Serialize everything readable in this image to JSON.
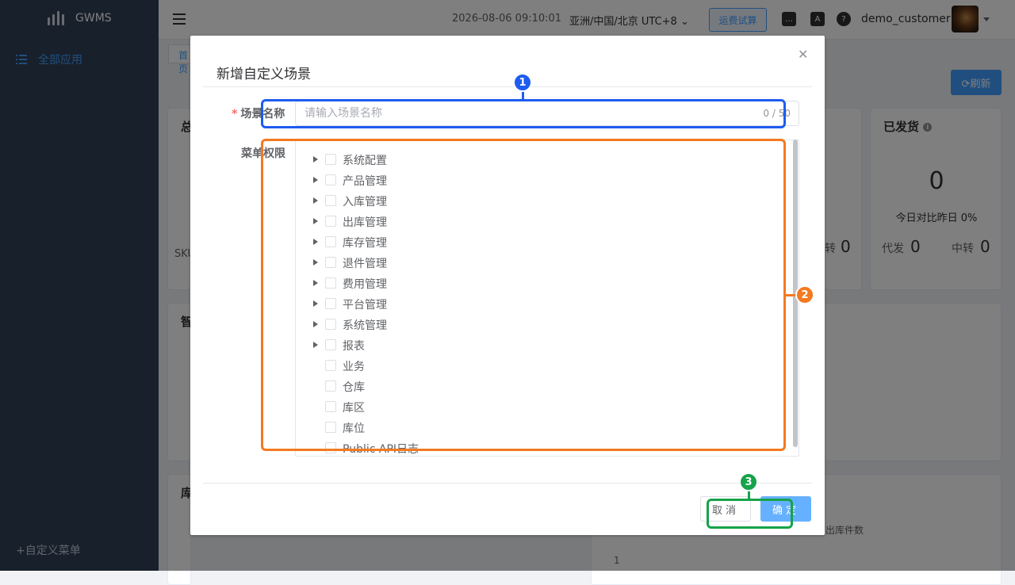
{
  "app": {
    "name": "GWMS"
  },
  "sidebar": {
    "all_apps": "全部应用",
    "custom_menu": "+自定义菜单"
  },
  "topbar": {
    "datetime": "2026-08-06 09:10:01",
    "timezone": "亚洲/中国/北京 UTC+8",
    "fee_trial": "运费试算",
    "username": "demo_customer",
    "translate_icon_text": "A"
  },
  "page": {
    "tab_home": "首页",
    "refresh": "⟳刷新",
    "card_total_title": "总",
    "card_smart_title": "智",
    "card_stock_title": "库",
    "sku_label": "SKU",
    "shipped": {
      "title": "已发货",
      "value": "0",
      "compare": "今日对比昨日 0%",
      "pending_label": "代发",
      "pending_value": "0",
      "transit_label": "中转",
      "transit_value": "0"
    },
    "mid_transit_label": "转",
    "mid_transit_value": "0",
    "chart_legend": "出库件数",
    "chart_tick": "1"
  },
  "dialog": {
    "title": "新增自定义场景",
    "name_label": "场景名称",
    "name_placeholder": "请输入场景名称",
    "name_counter": "0 / 50",
    "perm_label": "菜单权限",
    "tree_items": [
      {
        "label": "系统配置",
        "expandable": true
      },
      {
        "label": "产品管理",
        "expandable": true
      },
      {
        "label": "入库管理",
        "expandable": true
      },
      {
        "label": "出库管理",
        "expandable": true
      },
      {
        "label": "库存管理",
        "expandable": true
      },
      {
        "label": "退件管理",
        "expandable": true
      },
      {
        "label": "费用管理",
        "expandable": true
      },
      {
        "label": "平台管理",
        "expandable": true
      },
      {
        "label": "系统管理",
        "expandable": true
      },
      {
        "label": "报表",
        "expandable": true
      },
      {
        "label": "业务",
        "expandable": false
      },
      {
        "label": "仓库",
        "expandable": false
      },
      {
        "label": "库区",
        "expandable": false
      },
      {
        "label": "库位",
        "expandable": false
      },
      {
        "label": "Public API日志",
        "expandable": false
      }
    ],
    "cancel": "取消",
    "confirm": "确定"
  },
  "annotations": {
    "badge_1": "1",
    "badge_2": "2",
    "badge_3": "3",
    "colors": {
      "blue": "#1d5cf0",
      "orange": "#f47920",
      "green": "#16a34a"
    }
  }
}
